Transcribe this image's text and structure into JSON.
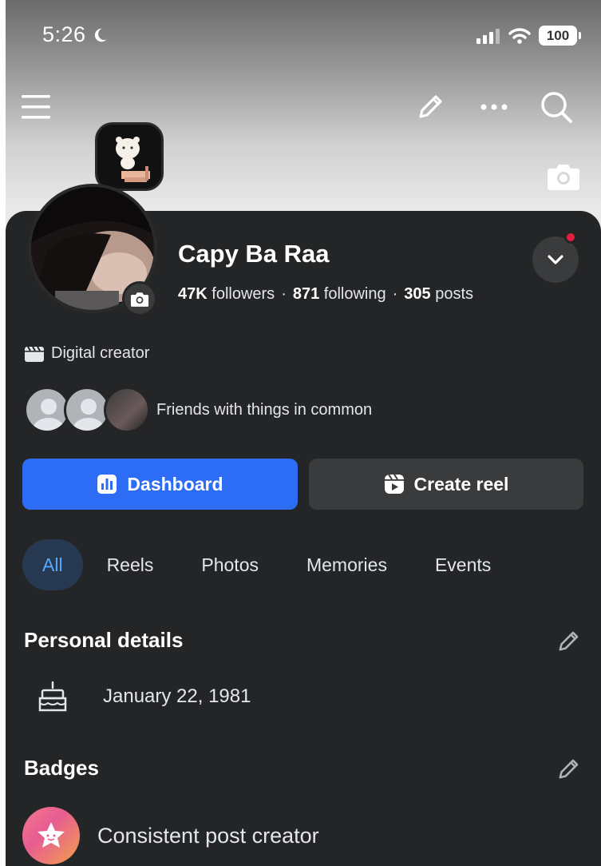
{
  "status_bar": {
    "time": "5:26",
    "battery": "100"
  },
  "profile": {
    "name": "Capy Ba Raa",
    "followers_count": "47K",
    "followers_label": "followers",
    "following_count": "871",
    "following_label": "following",
    "posts_count": "305",
    "posts_label": "posts",
    "category": "Digital creator",
    "friends_text": "Friends with things in common"
  },
  "actions": {
    "dashboard": "Dashboard",
    "create_reel": "Create reel"
  },
  "tabs": [
    "All",
    "Reels",
    "Photos",
    "Memories",
    "Events"
  ],
  "personal_details": {
    "title": "Personal details",
    "birthday": "January 22, 1981"
  },
  "badges": {
    "title": "Badges",
    "item": "Consistent post creator"
  },
  "colors": {
    "accent": "#2d6df6",
    "sheet_bg": "#242526",
    "active_tab_bg": "#263951",
    "notification": "#e41e3f"
  }
}
